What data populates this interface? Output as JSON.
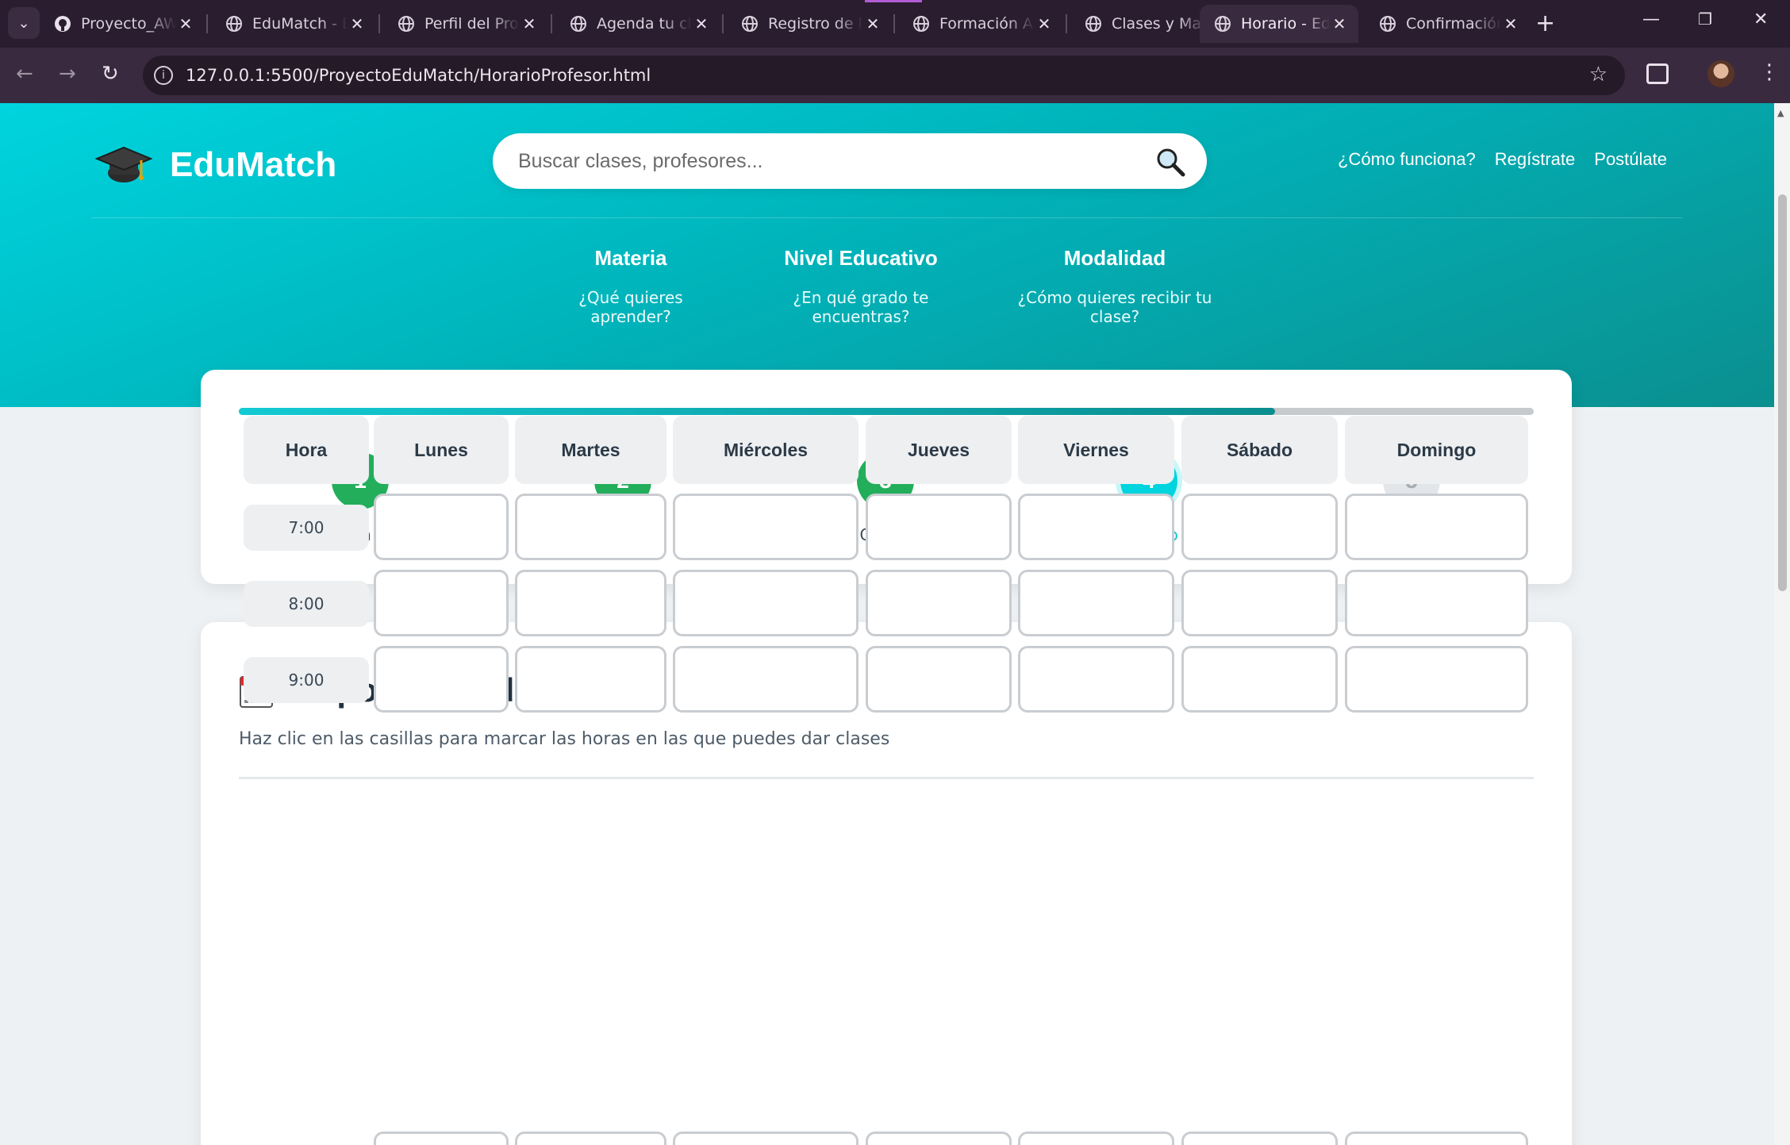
{
  "browser": {
    "tabs": [
      {
        "title": "Proyecto_AW",
        "icon": "github-icon"
      },
      {
        "title": "EduMatch - E",
        "icon": "globe-icon"
      },
      {
        "title": "Perfil del Pro",
        "icon": "globe-icon"
      },
      {
        "title": "Agenda tu cl",
        "icon": "globe-icon"
      },
      {
        "title": "Registro de l",
        "icon": "globe-icon"
      },
      {
        "title": "Formación A",
        "icon": "globe-icon"
      },
      {
        "title": "Clases y Mat",
        "icon": "globe-icon"
      },
      {
        "title": "Horario - Edu",
        "icon": "globe-icon",
        "active": true
      },
      {
        "title": "Confirmación",
        "icon": "globe-icon"
      }
    ],
    "url": "127.0.0.1:5500/ProyectoEduMatch/HorarioProfesor.html"
  },
  "header": {
    "brand": "EduMatch",
    "search_placeholder": "Buscar clases, profesores...",
    "links": [
      "¿Cómo funciona?",
      "Regístrate",
      "Postúlate"
    ]
  },
  "filters": [
    {
      "title": "Materia",
      "subtitle": "¿Qué quieres aprender?"
    },
    {
      "title": "Nivel Educativo",
      "subtitle": "¿En qué grado te encuentras?"
    },
    {
      "title": "Modalidad",
      "subtitle": "¿Cómo quieres recibir tu clase?"
    }
  ],
  "progress": {
    "fraction": 0.8,
    "steps": [
      {
        "number": "1",
        "label": "Información Personal",
        "state": "done"
      },
      {
        "number": "2",
        "label": "Formación",
        "state": "done"
      },
      {
        "number": "3",
        "label": "Clases",
        "state": "done"
      },
      {
        "number": "4",
        "label": "Horario",
        "state": "current"
      },
      {
        "number": "5",
        "label": "Confirmación",
        "state": "pending"
      }
    ]
  },
  "schedule": {
    "title": "Disponibilidad Semanal",
    "subtitle": "Haz clic en las casillas para marcar las horas en las que puedes dar clases",
    "hour_header": "Hora",
    "days": [
      "Lunes",
      "Martes",
      "Miércoles",
      "Jueves",
      "Viernes",
      "Sábado",
      "Domingo"
    ],
    "hours": [
      "7:00",
      "8:00",
      "9:00"
    ]
  },
  "colors": {
    "accent": "#00d4de",
    "done": "#22ae5a",
    "pending": "#e3e6e9"
  }
}
